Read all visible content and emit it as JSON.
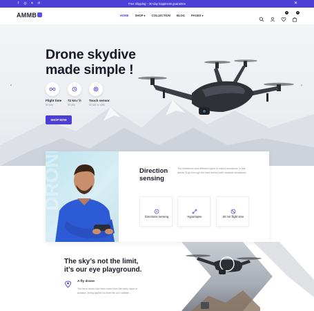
{
  "topbar": {
    "promo": "Free shipping – 30-day happiness guarantee",
    "social_icons": [
      "facebook-icon",
      "instagram-icon",
      "twitter-icon",
      "pinterest-icon"
    ],
    "bg_color": "#4b3fd8"
  },
  "nav": {
    "logo": "AMMB",
    "items": [
      {
        "label": "HOME",
        "active": true
      },
      {
        "label": "SHOP",
        "dropdown": true
      },
      {
        "label": "COLLECTION"
      },
      {
        "label": "BLOG"
      },
      {
        "label": "PAGES",
        "dropdown": true
      }
    ],
    "wishlist_count": "0",
    "cart_count": "0"
  },
  "hero": {
    "title_line1": "Drone skydive",
    "title_line2": "made simple !",
    "features": [
      {
        "title": "Flight time",
        "sub": "50 Min",
        "icon": "infinity-icon"
      },
      {
        "title": "72 km / h",
        "sub": "50 Min",
        "icon": "clock-icon"
      },
      {
        "title": "Touch sensor",
        "sub": "50 Min to 40M",
        "icon": "target-icon"
      }
    ],
    "cta": "SHOP NOW",
    "accent": "#4b3fd8"
  },
  "direction": {
    "title_line1": "Direction",
    "title_line2": "sensing",
    "text": "The limitations and different types of object avoidance in this article I'll go through the best drones with obstacle avoidance.",
    "features": [
      {
        "label": "Directions sensing",
        "icon": "crosshair-icon"
      },
      {
        "label": "Hyperlapse",
        "icon": "route-icon"
      },
      {
        "label": "60 mir flight time",
        "icon": "timer-icon"
      }
    ]
  },
  "bottom": {
    "title_line1": "The sky’s not the limit,",
    "title_line2": "it’s our eye playground.",
    "item_title": "A fly drone",
    "item_text": "The term drone has been used from the early days of aviation, being applied to both the our notable..."
  }
}
